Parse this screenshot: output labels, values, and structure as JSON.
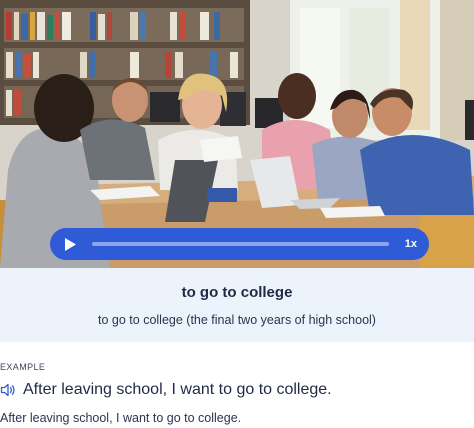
{
  "player": {
    "speed_label": "1x",
    "progress": 0.0,
    "accent_color": "#2f5bd7"
  },
  "term": {
    "title": "to go to college",
    "definition": "to go to college (the final two years of high school)"
  },
  "example": {
    "section_label": "EXAMPLE",
    "sentence": "After leaving school, I want to go to college.",
    "translation": "After leaving school, I want to go to college."
  },
  "icons": {
    "play": "play-icon",
    "speaker": "speaker-icon"
  }
}
